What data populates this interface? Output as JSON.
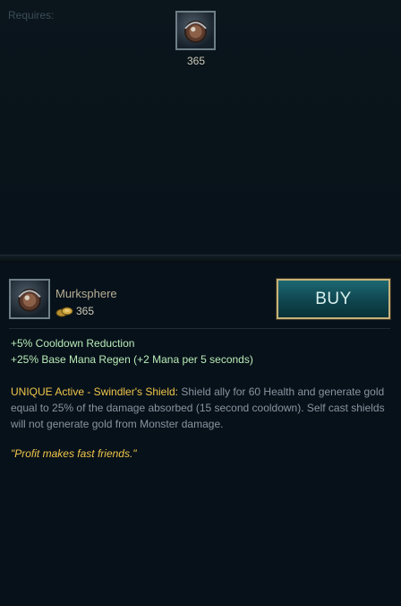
{
  "requires": {
    "label": "Requires:",
    "item": {
      "icon": "murksphere-icon",
      "cost": "365"
    }
  },
  "item": {
    "icon": "murksphere-icon",
    "name": "Murksphere",
    "cost": "365",
    "coin_icon": "gold-coins-icon",
    "buy_label": "BUY",
    "stats": [
      "+5% Cooldown Reduction",
      "+25% Base Mana Regen (+2 Mana per 5 seconds)"
    ],
    "unique_label": "UNIQUE Active - Swindler's Shield:",
    "unique_text": "Shield ally for 60 Health and generate gold equal to 25% of the damage absorbed (15 second cooldown). Self cast shields will not generate gold from Monster damage.",
    "quote": "\"Profit makes fast friends.\""
  },
  "colors": {
    "stat_green": "#b7ecb6",
    "unique_gold": "#f0c64a",
    "buy_border": "#c7b27b",
    "buy_fill": "#1d6872"
  }
}
